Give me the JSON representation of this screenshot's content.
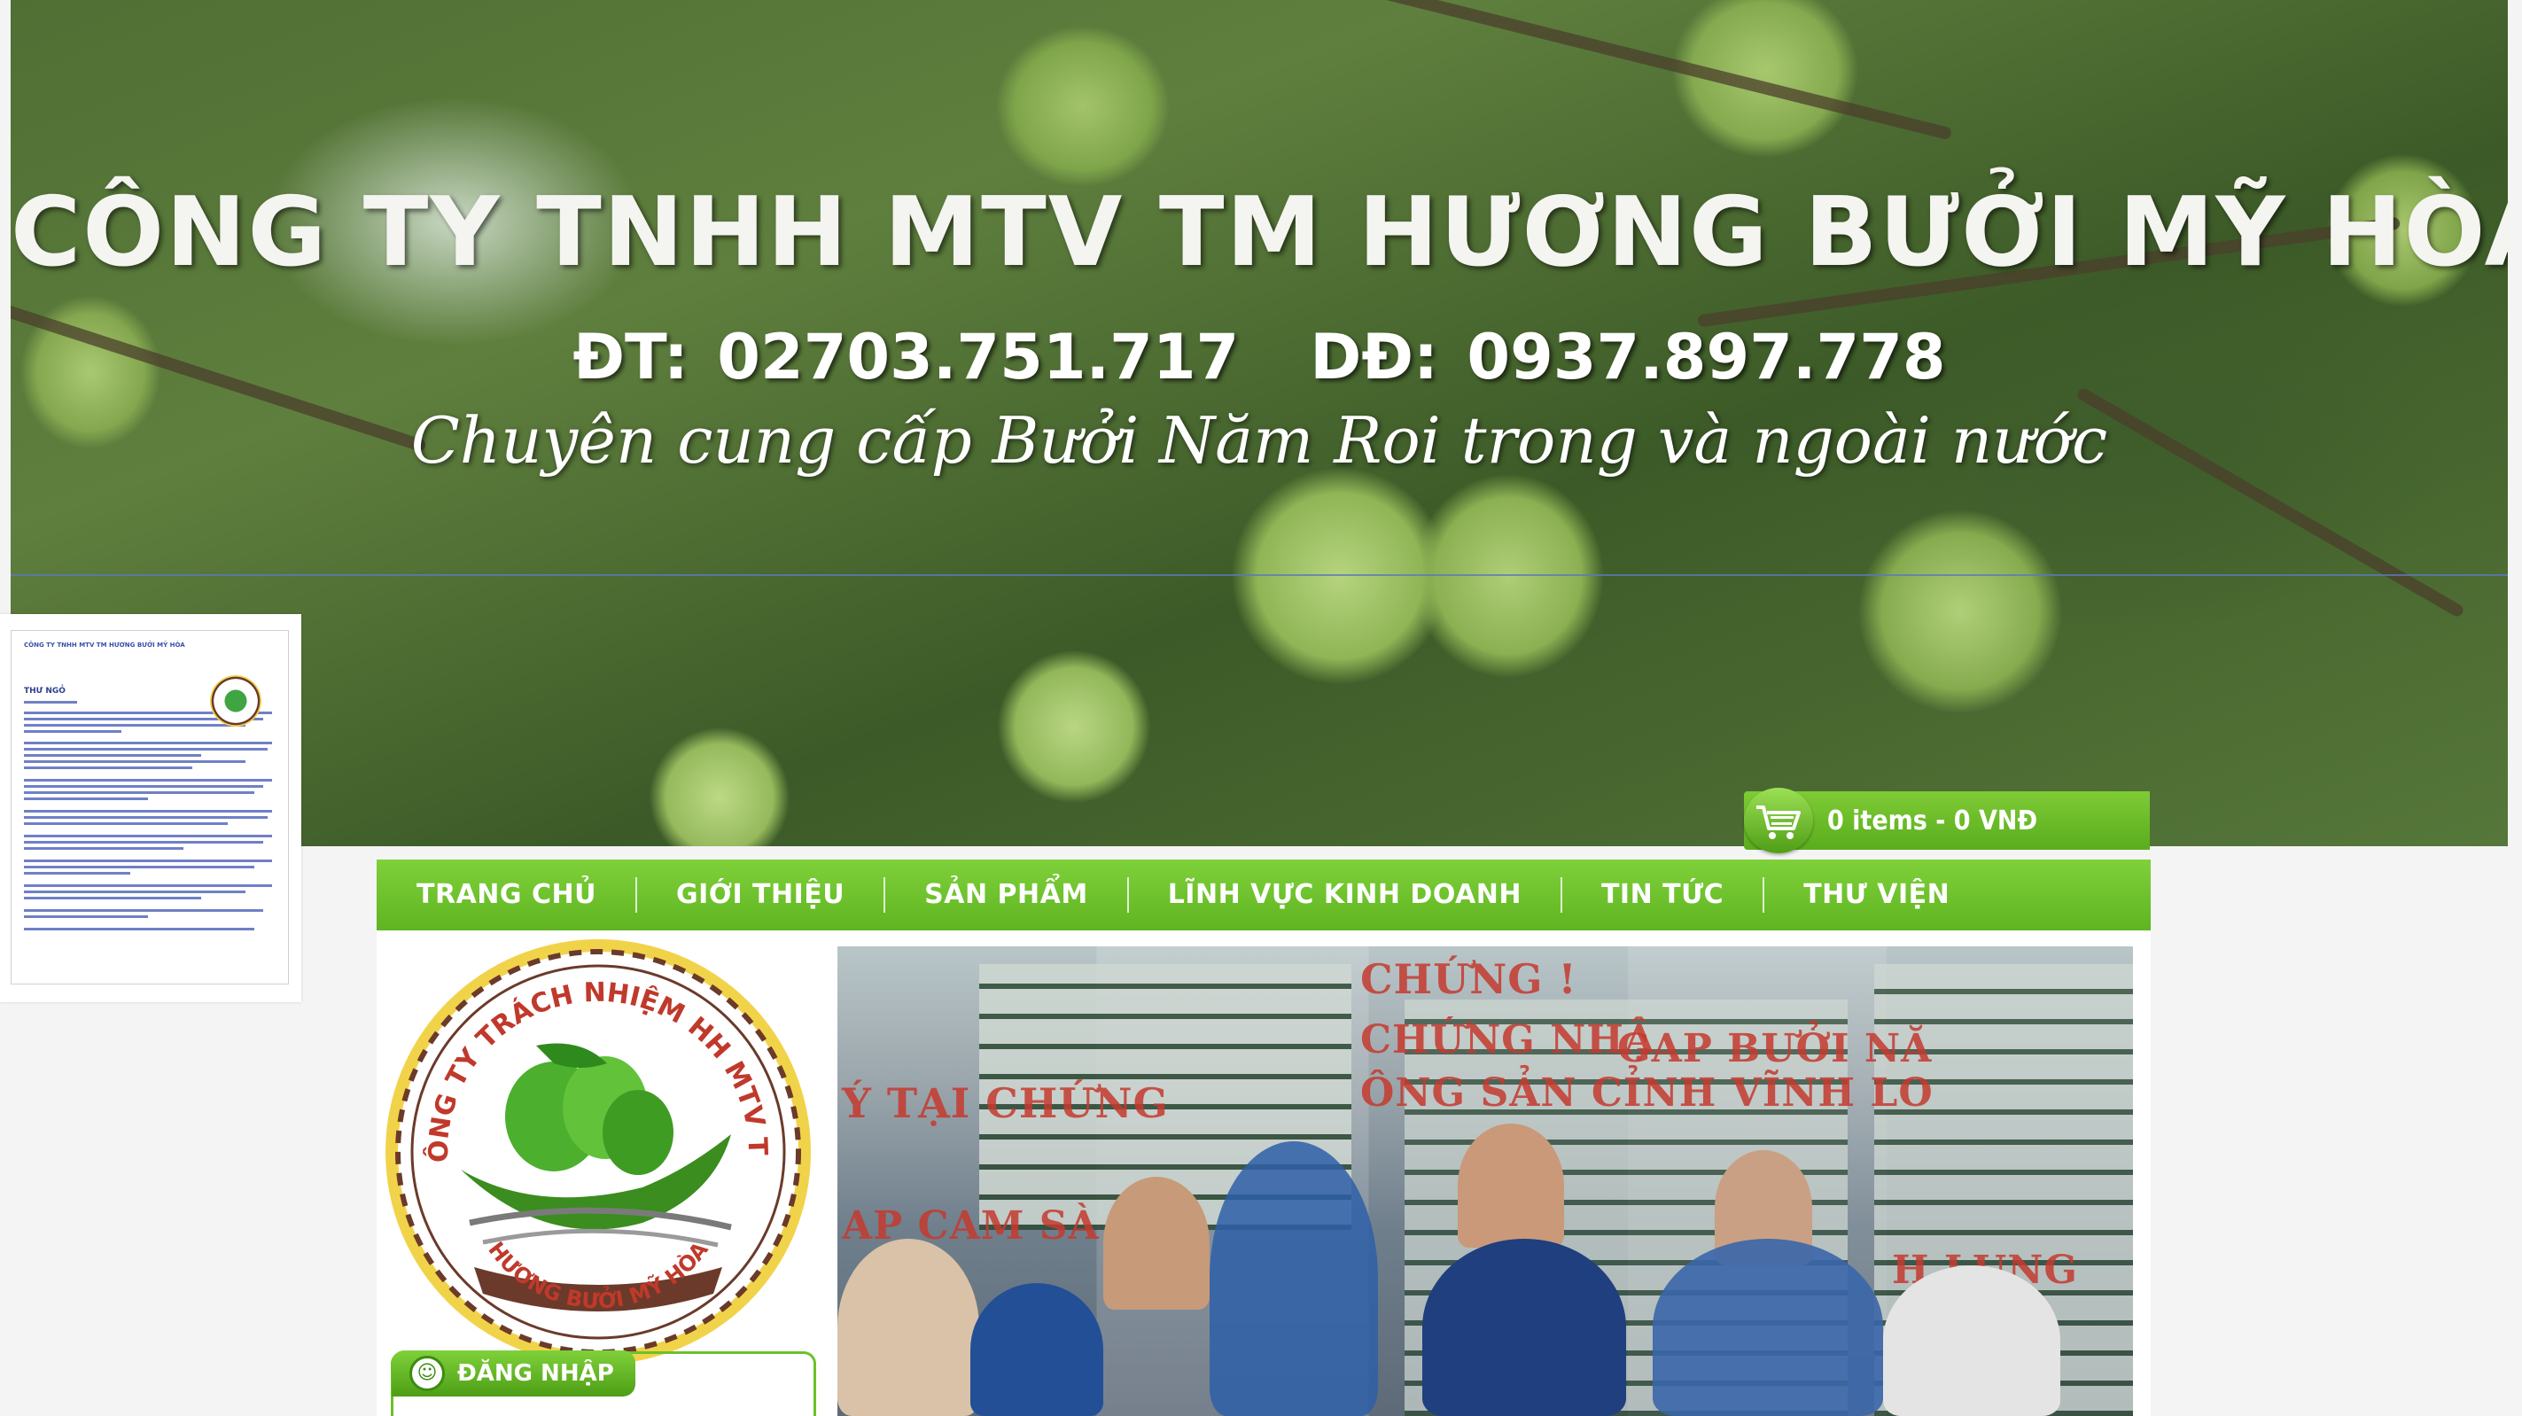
{
  "header": {
    "company_title": "CÔNG TY TNHH MTV TM HƯƠNG BƯỞI MỸ HÒA",
    "phone": "ĐT: 02703.751.717",
    "mobile": "DĐ: 0937.897.778",
    "slogan": "Chuyên cung cấp Bưởi Năm Roi trong và ngoài nước"
  },
  "cart": {
    "summary": "0 items - 0 VNĐ",
    "icon": "shopping-cart-icon"
  },
  "nav": {
    "items": [
      {
        "label": "TRANG CHỦ"
      },
      {
        "label": "GIỚI THIỆU"
      },
      {
        "label": "SẢN PHẨM"
      },
      {
        "label": "LĨNH VỰC KINH DOANH"
      },
      {
        "label": "TIN TỨC"
      },
      {
        "label": "THƯ VIỆN"
      }
    ]
  },
  "logo": {
    "top_text": "CÔNG TY TRÁCH NHIỆM HH MTV TM",
    "bottom_text": "HƯƠNG BƯỞI MỸ HÒA"
  },
  "login": {
    "label": "ĐĂNG NHẬP",
    "icon": "login-icon"
  },
  "letter_thumbnail": {
    "title": "CÔNG TY TNHH MTV TM HƯƠNG BƯỞI MỸ HÒA",
    "heading": "THƯ NGỎ"
  },
  "slideshow": {
    "captions": [
      "CHỨNG !",
      "CHỨNG NHẬ",
      "GAP BƯỞI NĂ",
      "Ý TẠI CHỨNG",
      "ÔNG SẢN CỈNH VĨNH LO",
      "AP CAM SÀ",
      "H LỤNG"
    ]
  },
  "colors": {
    "nav_green": "#6cc22c",
    "cart_green": "#6abd2a",
    "logo_ring": "#f1d34a",
    "logo_brown": "#6b3a2a",
    "logo_text_red": "#c0392b"
  }
}
